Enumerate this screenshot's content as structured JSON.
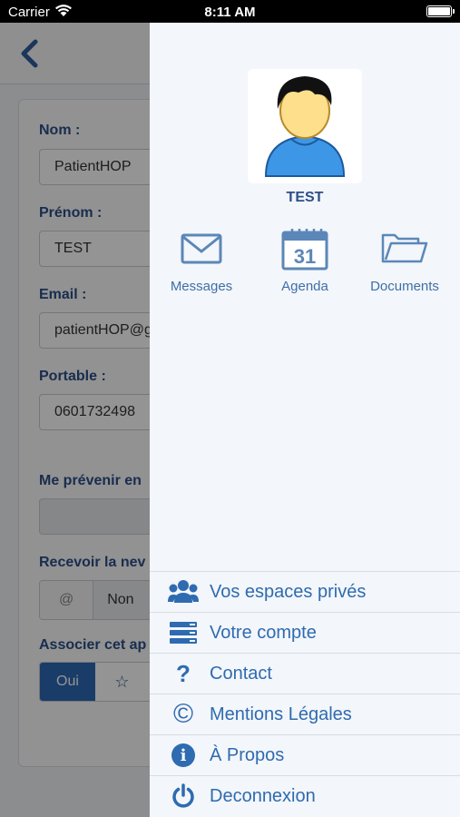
{
  "status_bar": {
    "carrier": "Carrier",
    "time": "8:11 AM"
  },
  "form": {
    "nom_label": "Nom :",
    "nom_value": "PatientHOP",
    "prenom_label": "Prénom :",
    "prenom_value": "TEST",
    "email_label": "Email :",
    "email_value": "patientHOP@g",
    "portable_label": "Portable :",
    "portable_value": "0601732498",
    "prevenir_label": "Me prévenir en",
    "newsletter_label": "Recevoir la nev",
    "newsletter_at": "@",
    "newsletter_option": "Non",
    "associer_label": "Associer cet ap",
    "associer_option": "Oui",
    "star_glyph": "☆"
  },
  "drawer": {
    "username": "TEST",
    "quick_actions": [
      {
        "label": "Messages",
        "icon": "envelope-icon"
      },
      {
        "label": "Agenda",
        "icon": "calendar-icon",
        "day": "31"
      },
      {
        "label": "Documents",
        "icon": "folder-icon"
      }
    ],
    "menu": [
      {
        "label": "Vos espaces privés",
        "icon": "users-icon"
      },
      {
        "label": "Votre compte",
        "icon": "list-icon"
      },
      {
        "label": "Contact",
        "icon": "question-icon",
        "glyph": "?"
      },
      {
        "label": "Mentions Légales",
        "icon": "copyright-icon",
        "glyph": "©"
      },
      {
        "label": "À Propos",
        "icon": "info-icon",
        "glyph": "i"
      },
      {
        "label": "Deconnexion",
        "icon": "power-icon"
      }
    ]
  },
  "colors": {
    "accent": "#2e6bb0",
    "label_blue": "#2c4f88",
    "drawer_bg": "#f3f6fa"
  }
}
